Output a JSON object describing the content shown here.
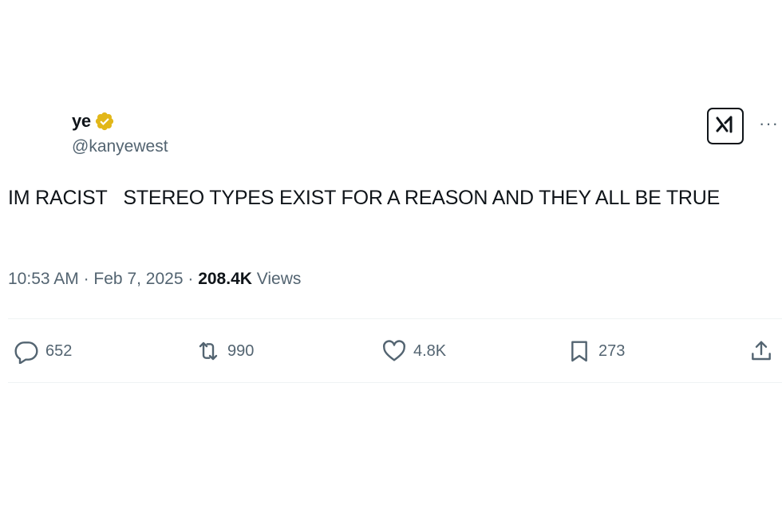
{
  "author": {
    "display_name": "ye",
    "handle": "@kanyewest",
    "verified_badge": "verified-badge-icon",
    "badge_color": "#e2b719"
  },
  "tweet": {
    "text": "IM RACIST   STEREO TYPES EXIST FOR A REASON AND THEY ALL BE TRUE",
    "time": "10:53 AM",
    "separator": "·",
    "date": "Feb 7, 2025",
    "views_count": "208.4K",
    "views_label": "Views"
  },
  "header_actions": {
    "grok_icon": "grok-icon",
    "more_label": "···"
  },
  "actions": {
    "replies": "652",
    "reposts": "990",
    "likes": "4.8K",
    "bookmarks": "273",
    "share_icon": "share-icon"
  },
  "colors": {
    "text_primary": "#0f1419",
    "text_secondary": "#536471",
    "divider": "#eff3f4"
  }
}
